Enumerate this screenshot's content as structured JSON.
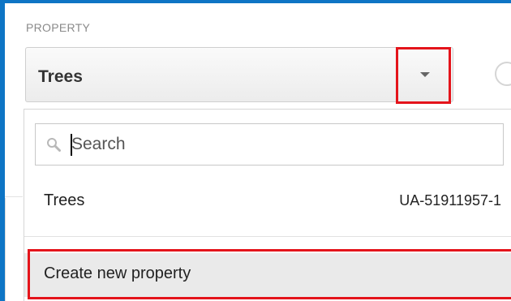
{
  "property": {
    "section_label": "PROPERTY",
    "selected_value": "Trees"
  },
  "dropdown": {
    "search_placeholder": "Search",
    "items": [
      {
        "label": "Trees",
        "id": "UA-51911957-1"
      }
    ],
    "create_label": "Create new property"
  },
  "colors": {
    "highlight": "#e4141b",
    "frame": "#0e75c5"
  },
  "icons": {
    "caret": "chevron-down-icon",
    "search": "search-icon"
  }
}
